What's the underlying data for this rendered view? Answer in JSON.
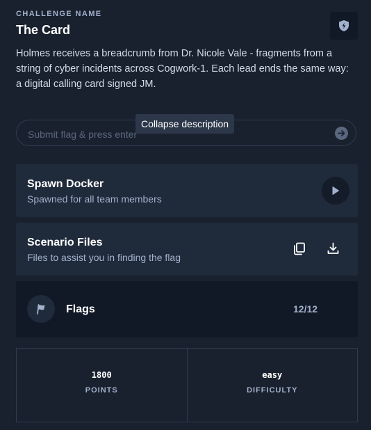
{
  "challenge": {
    "label": "CHALLENGE NAME",
    "title": "The Card",
    "description": "Holmes receives a breadcrumb from Dr. Nicole Vale - fragments from a string of cyber incidents across Cogwork-1. Each lead ends the same way: a digital calling card signed JM."
  },
  "flag_input": {
    "placeholder": "Submit flag & press enter",
    "value": ""
  },
  "tooltip": "Collapse description",
  "spawn_docker": {
    "title": "Spawn Docker",
    "subtitle": "Spawned for all team members"
  },
  "scenario_files": {
    "title": "Scenario Files",
    "subtitle": "Files to assist you in finding the flag"
  },
  "flags": {
    "label": "Flags",
    "count": "12/12"
  },
  "stats": {
    "points_value": "1800",
    "points_label": "POINTS",
    "difficulty_value": "easy",
    "difficulty_label": "DIFFICULTY"
  },
  "icons": {
    "shield": "shield-lightning-icon",
    "submit": "arrow-right-circle-icon",
    "play": "play-icon",
    "copy": "copy-icon",
    "download": "download-icon",
    "flag": "flag-icon"
  },
  "colors": {
    "background": "#19212e",
    "card": "#1f2a3b",
    "dark_panel": "#111927",
    "muted_text": "#a4b1cd",
    "border": "#2f3b50"
  }
}
